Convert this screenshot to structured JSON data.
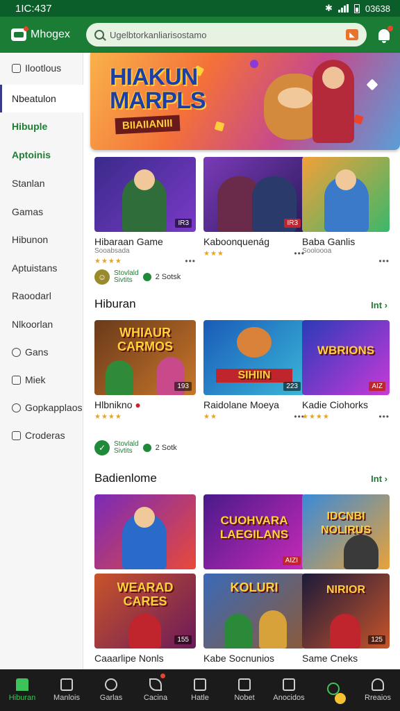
{
  "status_bar": {
    "time": "1IC:437",
    "right_text": "03638"
  },
  "app_bar": {
    "brand": "Mhogex",
    "search_value": "Ugelbtorkanliarisostamo"
  },
  "sidebar": {
    "items": [
      {
        "label": "Ilootlous"
      },
      {
        "label": "Nbeatulon"
      },
      {
        "label": "Hibuple"
      },
      {
        "label": "Aptoinis"
      },
      {
        "label": "Stanlan"
      },
      {
        "label": "Gamas"
      },
      {
        "label": "Hibunon"
      },
      {
        "label": "Aptuistans"
      },
      {
        "label": "Raoodarl"
      },
      {
        "label": "Nlkoorlan"
      },
      {
        "label": "Gans"
      },
      {
        "label": "Miek"
      },
      {
        "label": "Gopkapplaos"
      },
      {
        "label": "Croderas"
      }
    ]
  },
  "banner": {
    "title_line1": "HIAKUN",
    "title_line2": "MARPLS",
    "subtitle": "BIIAIIANIII"
  },
  "row1": [
    {
      "title": "Hibaraan Game",
      "sub": "Sooabsada",
      "tag": "IR3",
      "rating": 4
    },
    {
      "title": "Kaboonquenág",
      "sub": "",
      "tag": "IR3",
      "rating": 3
    },
    {
      "title": "Baba Ganlis",
      "sub": "Sooloooa",
      "tag": "",
      "rating": 0
    }
  ],
  "social1": {
    "label_top": "Stovlald",
    "label_bottom": "Sivtits",
    "count": "2 Sotsk"
  },
  "section1": {
    "title": "Hiburan",
    "see_all": "Int"
  },
  "row2": [
    {
      "title": "Hlbnikno",
      "thumb_text": "WHIAUR CARMOS",
      "tag": "193",
      "rating": 4
    },
    {
      "title": "Raidolane Moeya",
      "thumb_text": "SIHIIN",
      "tag": "223",
      "rating": 2
    },
    {
      "title": "Kadie Ciohorks",
      "thumb_text": "WBRIONS",
      "tag": "AIZ",
      "rating": 4
    }
  ],
  "social2": {
    "label_top": "Stovlald",
    "label_bottom": "Sivtits",
    "count": "2 Sotk"
  },
  "section2": {
    "title": "Badienlome",
    "see_all": "Int"
  },
  "row3": [
    {
      "title": "",
      "thumb_text": "",
      "tag": ""
    },
    {
      "title": "",
      "thumb_text": "CUOHVARA LAEGILANS",
      "tag": "AIZI"
    },
    {
      "title": "",
      "thumb_text": "IDCNBI NOLIRUS",
      "tag": ""
    }
  ],
  "row4": [
    {
      "title": "Caaarlipe Nonls",
      "thumb_text": "WEARAD CARES",
      "tag": "155"
    },
    {
      "title": "Kabe Socnunios",
      "thumb_text": "KOLURI",
      "tag": ""
    },
    {
      "title": "Same Cneks",
      "thumb_text": "NIRIOR",
      "tag": "125"
    }
  ],
  "bottom_nav": [
    {
      "label": "Hiburan"
    },
    {
      "label": "Manlois"
    },
    {
      "label": "Garlas"
    },
    {
      "label": "Cacina"
    },
    {
      "label": "Hatle"
    },
    {
      "label": "Nobet"
    },
    {
      "label": "Anocidos"
    },
    {
      "label": ""
    },
    {
      "label": "Rreaios"
    }
  ],
  "colors": {
    "primary": "#1b7c35",
    "status_bar": "#0b5e2a",
    "accent": "#3cc35a",
    "star": "#e8a320"
  }
}
